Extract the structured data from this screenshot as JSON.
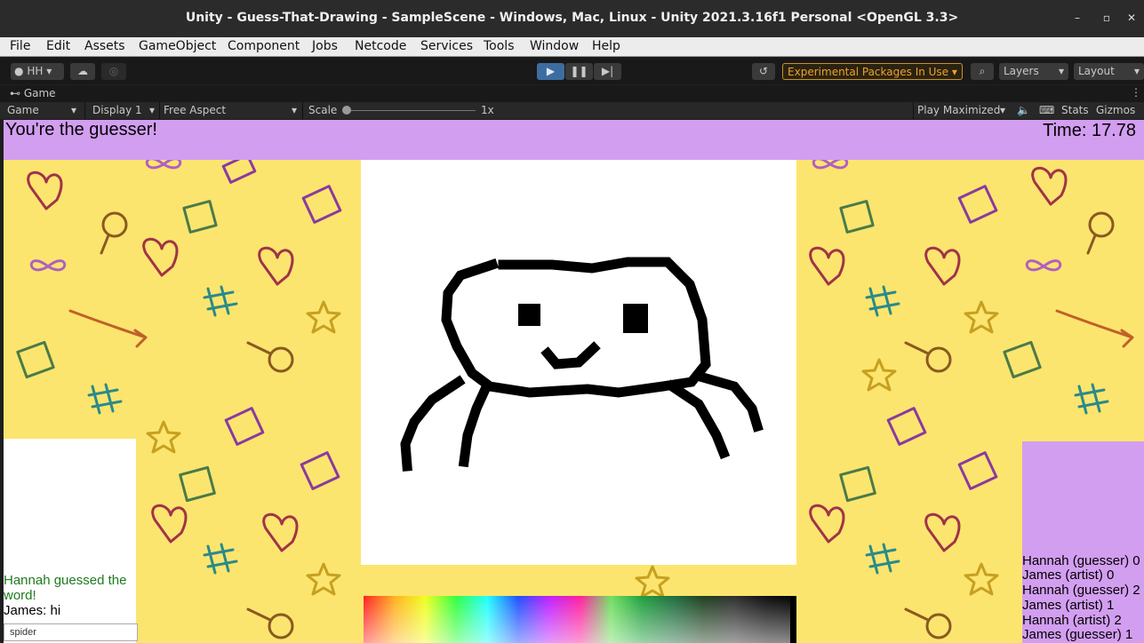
{
  "window": {
    "title": "Unity - Guess-That-Drawing - SampleScene - Windows, Mac, Linux - Unity 2021.3.16f1 Personal <OpenGL 3.3>",
    "minimize": "–",
    "maximize": "▫",
    "close": "✕"
  },
  "menu": [
    "File",
    "Edit",
    "Assets",
    "GameObject",
    "Component",
    "Jobs",
    "Netcode",
    "Services",
    "Tools",
    "Window",
    "Help"
  ],
  "toolbar": {
    "account": "HH",
    "experimental": "Experimental Packages In Use",
    "layers": "Layers",
    "layout": "Layout"
  },
  "tab": {
    "label": "Game"
  },
  "gamebar": {
    "mode": "Game",
    "display": "Display 1",
    "aspect": "Free Aspect",
    "scale_label": "Scale",
    "scale_value": "1x",
    "play_mode": "Play Maximized",
    "stats": "Stats",
    "gizmos": "Gizmos"
  },
  "game": {
    "role_text": "You're the guesser!",
    "timer_text": "Time: 17.78",
    "chat": {
      "lines": [
        {
          "text": "Hannah guessed the word!",
          "kind": "guess"
        },
        {
          "text": "James: hi",
          "kind": "msg"
        }
      ],
      "input_value": "spider"
    },
    "scores": [
      "Hannah (guesser) 0",
      "James (artist) 0",
      "Hannah (guesser) 2",
      "James (artist) 1",
      "Hannah (artist) 2",
      "James (guesser) 1"
    ]
  },
  "colors": {
    "accent_purple": "#d29ef0",
    "background_yellow": "#fce56e",
    "experimental_orange": "#f0a030"
  }
}
